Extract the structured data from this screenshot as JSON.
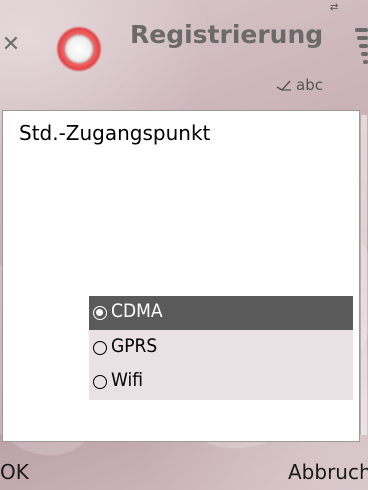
{
  "header": {
    "title": "Registrierung",
    "input_indicator": "abc",
    "icons": {
      "close": "close-icon",
      "app": "app-icon",
      "signal": "signal-strength-icon",
      "connection": "connection-icon",
      "pen": "pen-input-icon"
    }
  },
  "dialog": {
    "title": "Std.-Zugangspunkt",
    "options": [
      {
        "label": "CDMA",
        "selected": true
      },
      {
        "label": "GPRS",
        "selected": false
      },
      {
        "label": "Wifi",
        "selected": false
      }
    ]
  },
  "softkeys": {
    "left": "OK",
    "right": "Abbruch"
  },
  "colors": {
    "selection": "#5a5a5a",
    "title_text": "#6a6a6a",
    "options_bg": "#e9e1e3"
  }
}
